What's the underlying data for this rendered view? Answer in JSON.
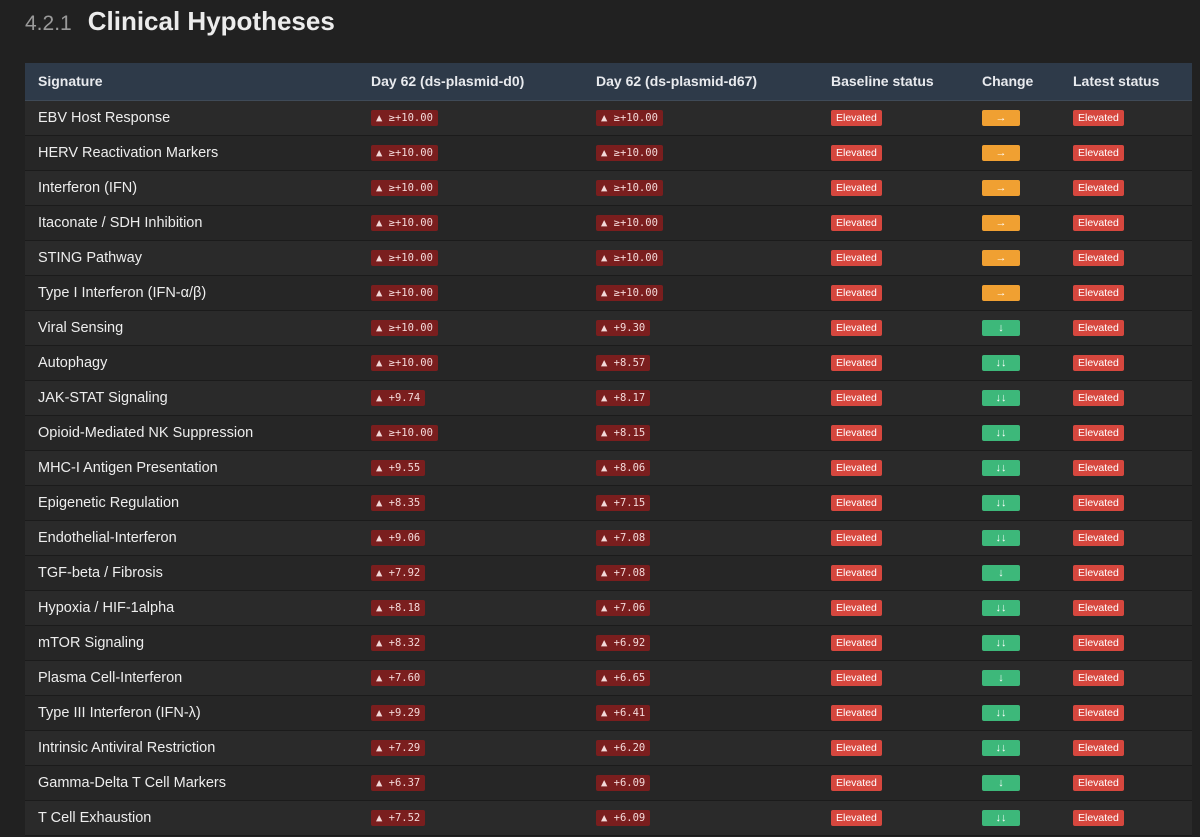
{
  "section": {
    "number": "4.2.1",
    "title": "Clinical Hypotheses"
  },
  "table": {
    "headers": {
      "signature": "Signature",
      "day62_d0": "Day 62 (ds-plasmid-d0)",
      "day62_d67": "Day 62 (ds-plasmid-d67)",
      "baseline": "Baseline status",
      "change": "Change",
      "latest": "Latest status"
    },
    "colors": {
      "value_badge": "#7a1e1e",
      "elevated_badge": "#d6473e",
      "change_flat": "#f0a032",
      "change_down": "#3db87a",
      "header_bg": "#2e3a49"
    },
    "rows": [
      {
        "signature": "EBV Host Response",
        "d0": "▲ ≥+10.00",
        "d67": "▲ ≥+10.00",
        "baseline": "Elevated",
        "change": "→",
        "change_type": "flat",
        "latest": "Elevated"
      },
      {
        "signature": "HERV Reactivation Markers",
        "d0": "▲ ≥+10.00",
        "d67": "▲ ≥+10.00",
        "baseline": "Elevated",
        "change": "→",
        "change_type": "flat",
        "latest": "Elevated"
      },
      {
        "signature": "Interferon (IFN)",
        "d0": "▲ ≥+10.00",
        "d67": "▲ ≥+10.00",
        "baseline": "Elevated",
        "change": "→",
        "change_type": "flat",
        "latest": "Elevated"
      },
      {
        "signature": "Itaconate / SDH Inhibition",
        "d0": "▲ ≥+10.00",
        "d67": "▲ ≥+10.00",
        "baseline": "Elevated",
        "change": "→",
        "change_type": "flat",
        "latest": "Elevated"
      },
      {
        "signature": "STING Pathway",
        "d0": "▲ ≥+10.00",
        "d67": "▲ ≥+10.00",
        "baseline": "Elevated",
        "change": "→",
        "change_type": "flat",
        "latest": "Elevated"
      },
      {
        "signature": "Type I Interferon (IFN-α/β)",
        "d0": "▲ ≥+10.00",
        "d67": "▲ ≥+10.00",
        "baseline": "Elevated",
        "change": "→",
        "change_type": "flat",
        "latest": "Elevated"
      },
      {
        "signature": "Viral Sensing",
        "d0": "▲ ≥+10.00",
        "d67": "▲ +9.30",
        "baseline": "Elevated",
        "change": "↓",
        "change_type": "down",
        "latest": "Elevated"
      },
      {
        "signature": "Autophagy",
        "d0": "▲ ≥+10.00",
        "d67": "▲ +8.57",
        "baseline": "Elevated",
        "change": "↓↓",
        "change_type": "down",
        "latest": "Elevated"
      },
      {
        "signature": "JAK-STAT Signaling",
        "d0": "▲ +9.74",
        "d67": "▲ +8.17",
        "baseline": "Elevated",
        "change": "↓↓",
        "change_type": "down",
        "latest": "Elevated"
      },
      {
        "signature": "Opioid-Mediated NK Suppression",
        "d0": "▲ ≥+10.00",
        "d67": "▲ +8.15",
        "baseline": "Elevated",
        "change": "↓↓",
        "change_type": "down",
        "latest": "Elevated"
      },
      {
        "signature": "MHC-I Antigen Presentation",
        "d0": "▲ +9.55",
        "d67": "▲ +8.06",
        "baseline": "Elevated",
        "change": "↓↓",
        "change_type": "down",
        "latest": "Elevated"
      },
      {
        "signature": "Epigenetic Regulation",
        "d0": "▲ +8.35",
        "d67": "▲ +7.15",
        "baseline": "Elevated",
        "change": "↓↓",
        "change_type": "down",
        "latest": "Elevated"
      },
      {
        "signature": "Endothelial-Interferon",
        "d0": "▲ +9.06",
        "d67": "▲ +7.08",
        "baseline": "Elevated",
        "change": "↓↓",
        "change_type": "down",
        "latest": "Elevated"
      },
      {
        "signature": "TGF-beta / Fibrosis",
        "d0": "▲ +7.92",
        "d67": "▲ +7.08",
        "baseline": "Elevated",
        "change": "↓",
        "change_type": "down",
        "latest": "Elevated"
      },
      {
        "signature": "Hypoxia / HIF-1alpha",
        "d0": "▲ +8.18",
        "d67": "▲ +7.06",
        "baseline": "Elevated",
        "change": "↓↓",
        "change_type": "down",
        "latest": "Elevated"
      },
      {
        "signature": "mTOR Signaling",
        "d0": "▲ +8.32",
        "d67": "▲ +6.92",
        "baseline": "Elevated",
        "change": "↓↓",
        "change_type": "down",
        "latest": "Elevated"
      },
      {
        "signature": "Plasma Cell-Interferon",
        "d0": "▲ +7.60",
        "d67": "▲ +6.65",
        "baseline": "Elevated",
        "change": "↓",
        "change_type": "down",
        "latest": "Elevated"
      },
      {
        "signature": "Type III Interferon (IFN-λ)",
        "d0": "▲ +9.29",
        "d67": "▲ +6.41",
        "baseline": "Elevated",
        "change": "↓↓",
        "change_type": "down",
        "latest": "Elevated"
      },
      {
        "signature": "Intrinsic Antiviral Restriction",
        "d0": "▲ +7.29",
        "d67": "▲ +6.20",
        "baseline": "Elevated",
        "change": "↓↓",
        "change_type": "down",
        "latest": "Elevated"
      },
      {
        "signature": "Gamma-Delta T Cell Markers",
        "d0": "▲ +6.37",
        "d67": "▲ +6.09",
        "baseline": "Elevated",
        "change": "↓",
        "change_type": "down",
        "latest": "Elevated"
      },
      {
        "signature": "T Cell Exhaustion",
        "d0": "▲ +7.52",
        "d67": "▲ +6.09",
        "baseline": "Elevated",
        "change": "↓↓",
        "change_type": "down",
        "latest": "Elevated"
      }
    ]
  }
}
